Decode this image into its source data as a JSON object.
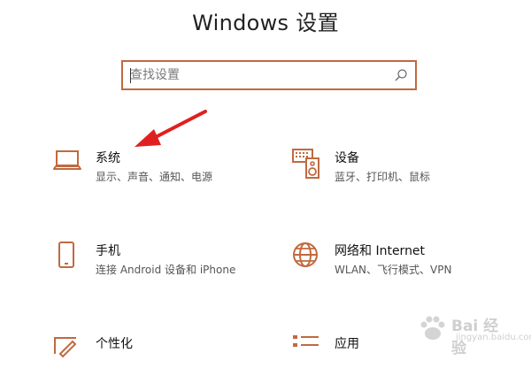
{
  "window": {
    "title": "Windows 设置"
  },
  "search": {
    "placeholder": "查找设置",
    "icon": "search-icon"
  },
  "colors": {
    "accent": "#c06a3f",
    "arrow": "#e02020"
  },
  "tiles": [
    {
      "name": "系统",
      "desc": "显示、声音、通知、电源",
      "icon": "laptop-icon"
    },
    {
      "name": "设备",
      "desc": "蓝牙、打印机、鼠标",
      "icon": "devices-icon"
    },
    {
      "name": "手机",
      "desc": "连接 Android 设备和 iPhone",
      "icon": "phone-icon"
    },
    {
      "name": "网络和 Internet",
      "desc": "WLAN、飞行模式、VPN",
      "icon": "globe-icon"
    },
    {
      "name": "个性化",
      "desc": "",
      "icon": "paintbrush-icon"
    },
    {
      "name": "应用",
      "desc": "",
      "icon": "apps-list-icon"
    }
  ],
  "watermark": {
    "line1": "Bai 经验",
    "line2": "jingyan.baidu.com"
  }
}
